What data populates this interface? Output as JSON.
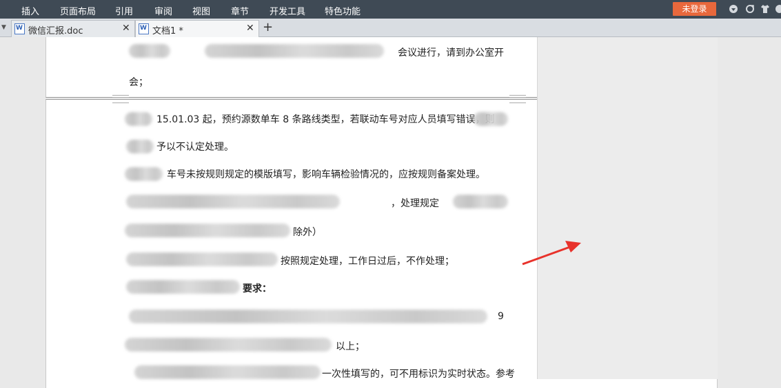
{
  "menu": {
    "items": [
      "插入",
      "页面布局",
      "引用",
      "审阅",
      "视图",
      "章节",
      "开发工具",
      "特色功能"
    ],
    "login": "未登录"
  },
  "tabs": [
    {
      "label": "微信汇报.doc",
      "active": false
    },
    {
      "label": "文档1 *",
      "active": true
    }
  ],
  "document": {
    "page1_lines": [
      "会议进行，请到办公室开",
      "会；"
    ],
    "page2_lines": [
      "15.01.03 起，预约源数单车 8 条路线类型，若联动车号对应人员填写错误，则",
      "予以不认定处理。",
      "车号未按规则规定的模版填写，影响车辆检验情况的，应按规则备案处理。",
      "，处理规定",
      "除外）",
      "按照规定处理，工作日过后，不作处理；",
      "要求：",
      "9",
      "以上；",
      "一次性填写的，可不用标识为实时状态。参考"
    ]
  },
  "colors": {
    "menubar": "#3f4a55",
    "login": "#e8683c",
    "arrow": "#e8322b"
  },
  "icons": [
    "tab-list-arrow-icon",
    "word-doc-icon",
    "close-icon",
    "add-tab-icon",
    "skin-icon",
    "sync-icon",
    "shirt-icon",
    "help-icon"
  ]
}
